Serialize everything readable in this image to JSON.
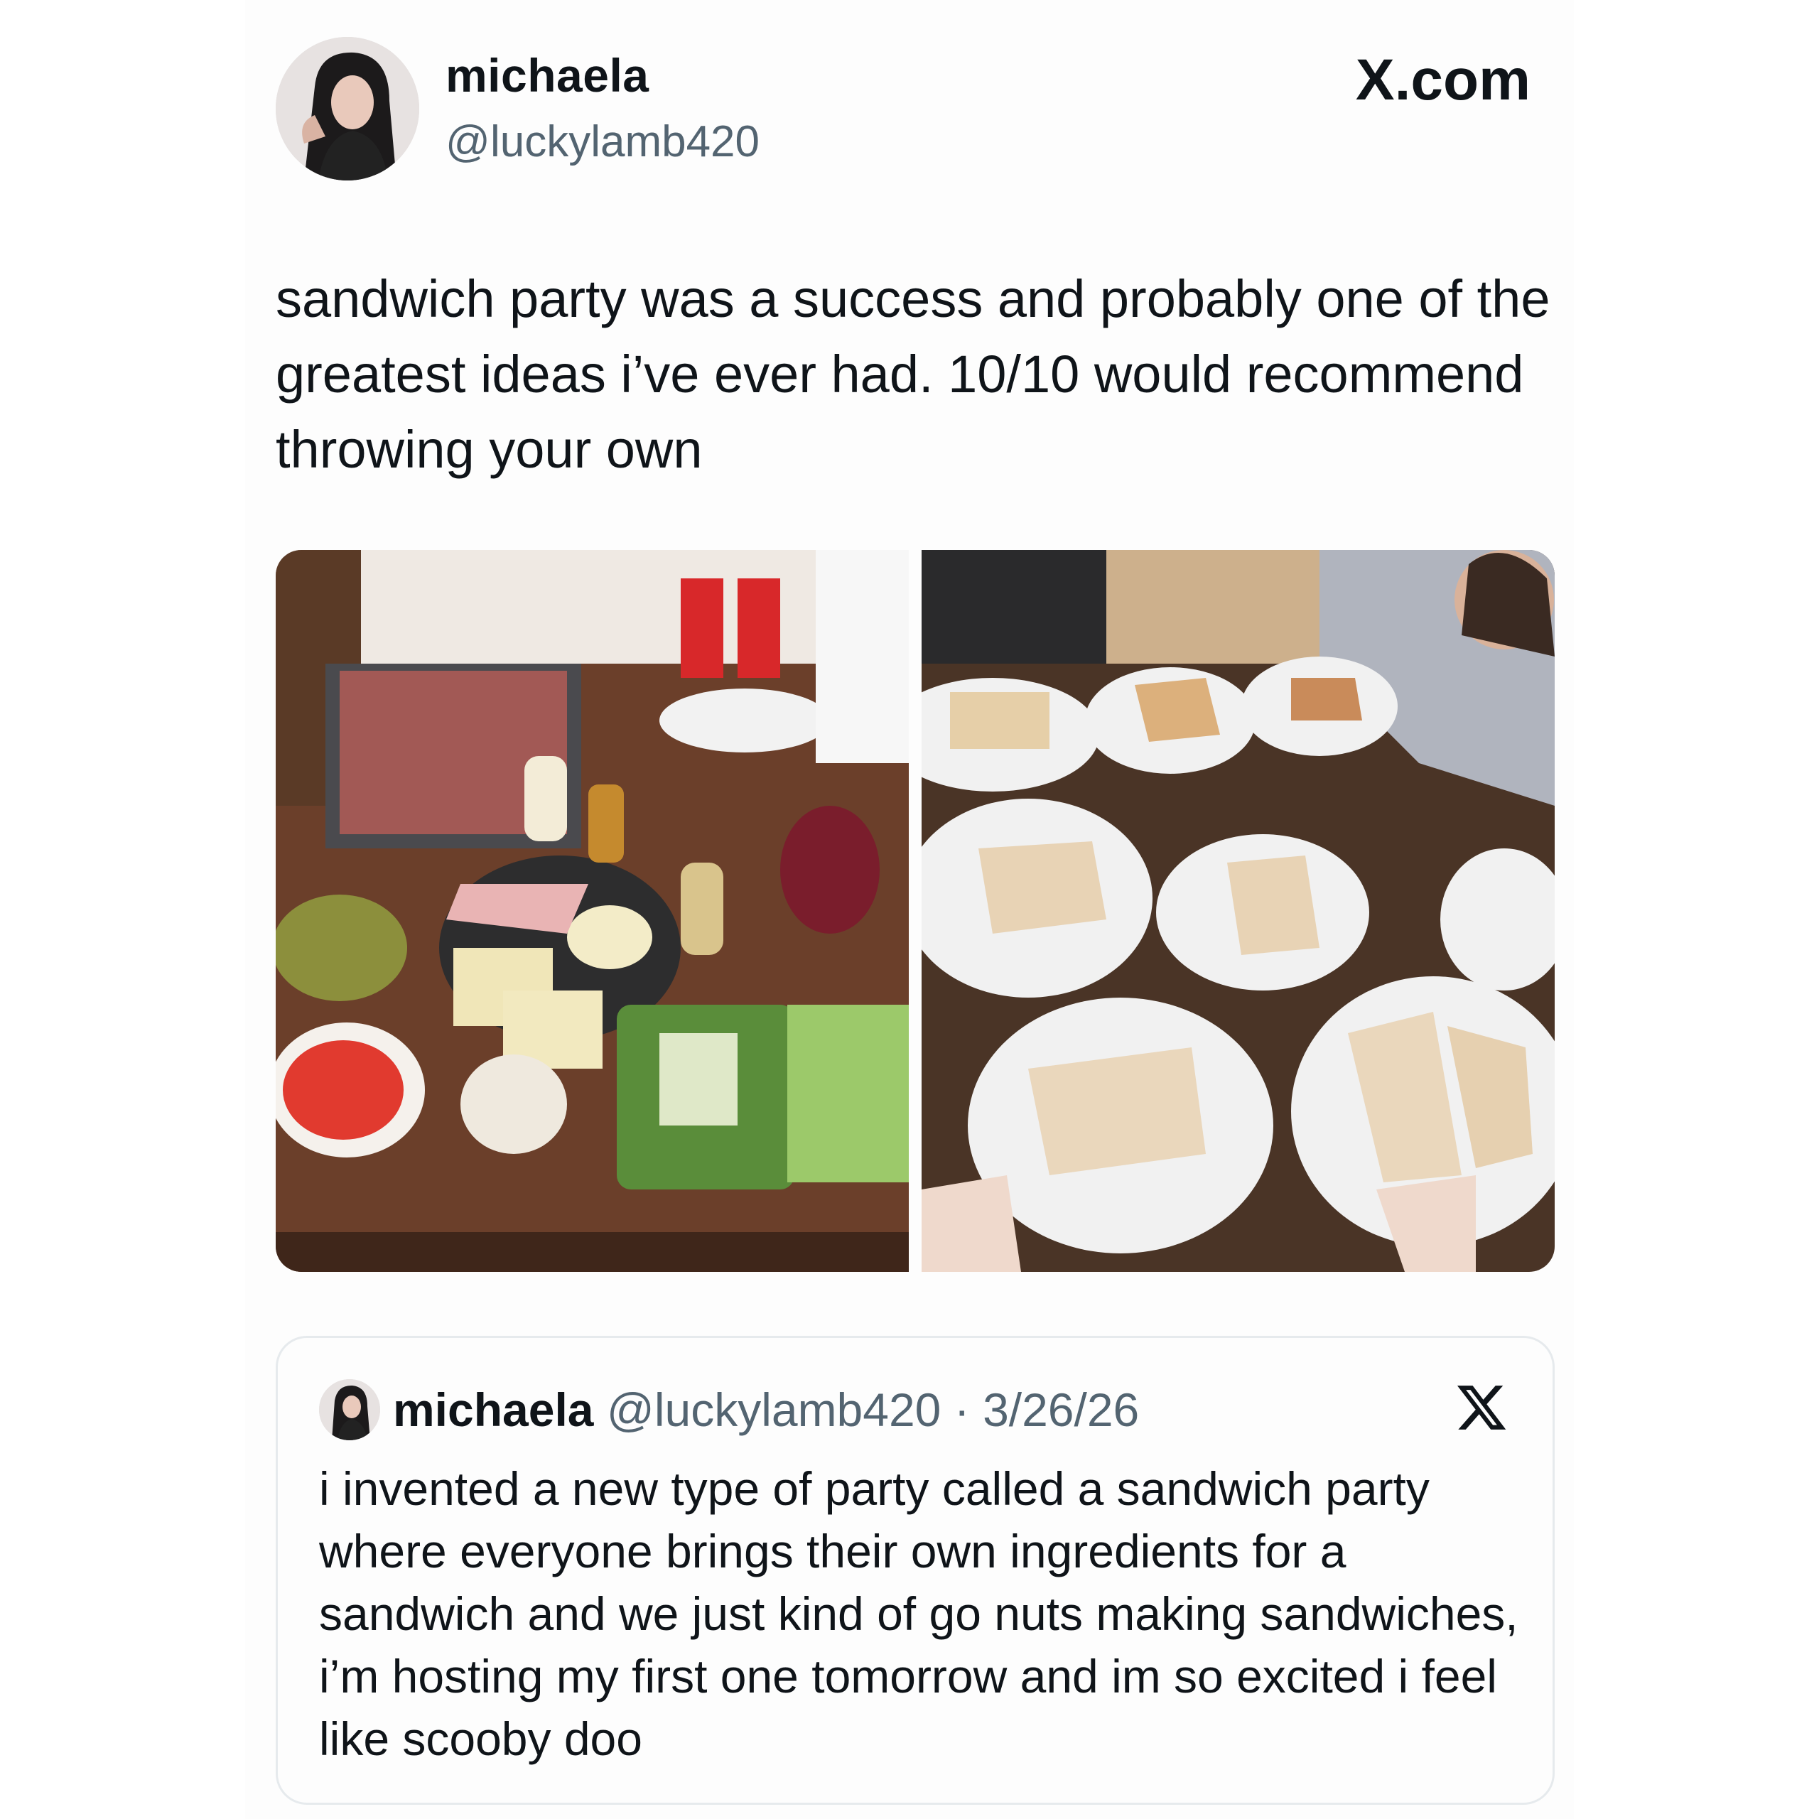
{
  "post": {
    "author": {
      "display_name": "michaela",
      "handle": "@luckylamb420"
    },
    "brand": "X.com",
    "text": "sandwich party was a success and probably one of the greatest ideas i’ve ever had. 10/10 would recommend throwing your own",
    "media": [
      {
        "icon": "photo-sandwich-ingredients-table"
      },
      {
        "icon": "photo-sandwiches-on-plates"
      }
    ]
  },
  "quoted_post": {
    "display_name": "michaela",
    "handle": "@luckylamb420",
    "separator": "·",
    "date": "3/26/26",
    "text": "i invented a new type of party called a sandwich party where everyone brings their own ingredients for a sandwich and we just kind of go nuts making sandwiches, i’m hosting my first one tomorrow and im so excited i feel like scooby doo",
    "icon": "x-logo-icon"
  },
  "colors": {
    "text_primary": "#0f1419",
    "text_secondary": "#536471",
    "border": "#e6eaed"
  }
}
